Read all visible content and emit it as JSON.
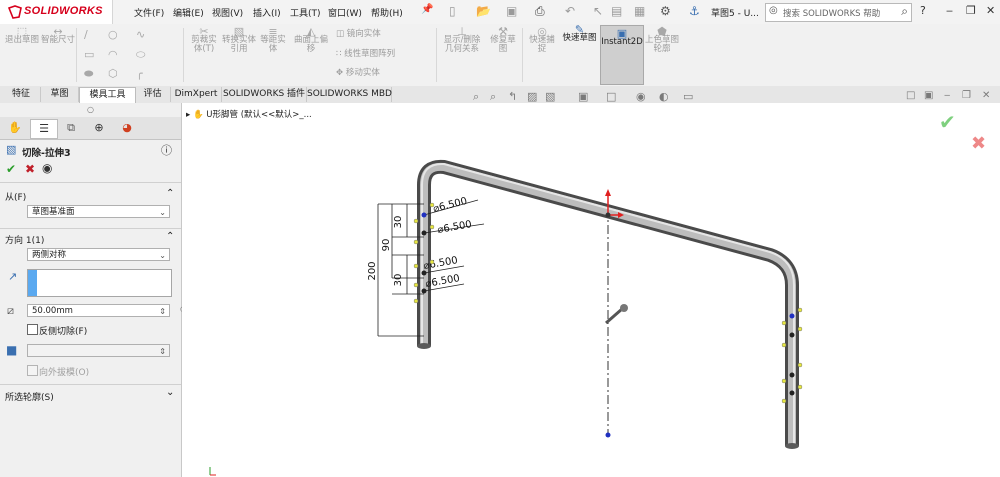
{
  "app": {
    "brand": "SOLIDWORKS",
    "doc_title": "草图5 - U..."
  },
  "menu": [
    {
      "key": "file",
      "label": "文件(F)"
    },
    {
      "key": "edit",
      "label": "编辑(E)"
    },
    {
      "key": "view",
      "label": "视图(V)"
    },
    {
      "key": "insert",
      "label": "插入(I)"
    },
    {
      "key": "tools",
      "label": "工具(T)"
    },
    {
      "key": "window",
      "label": "窗口(W)"
    },
    {
      "key": "help",
      "label": "帮助(H)"
    }
  ],
  "search": {
    "placeholder": "搜索 SOLIDWORKS 帮助"
  },
  "ribbon": {
    "exit_sketch": "退出草图",
    "smart_dim": "智能尺寸",
    "trim": "剪裁实体(T)",
    "convert": "转换实体引用",
    "offset": "等距实体",
    "surface_offset": "曲面上偏移",
    "mirror": "镜向实体",
    "linear_pattern": "线性草图阵列",
    "move": "移动实体",
    "display_delete": "显示/删除几何关系",
    "repair": "修复草图",
    "quick_snap": "快速捕捉",
    "quick_sketch": "快速草图",
    "instant2d": "Instant2D",
    "shaded_sketch": "上色草图轮廓"
  },
  "tabs": [
    {
      "key": "feature",
      "label": "特征"
    },
    {
      "key": "sketch",
      "label": "草图"
    },
    {
      "key": "mold",
      "label": "模具工具"
    },
    {
      "key": "evaluate",
      "label": "评估"
    },
    {
      "key": "dimxpert",
      "label": "DimXpert"
    },
    {
      "key": "addins",
      "label": "SOLIDWORKS 插件"
    },
    {
      "key": "mbd",
      "label": "SOLIDWORKS MBD"
    }
  ],
  "property_manager": {
    "title": "切除-拉伸3",
    "from": {
      "header": "从(F)",
      "value": "草图基准面"
    },
    "direction": {
      "header": "方向 1(1)",
      "end_condition": "两侧对称",
      "depth": "50.00mm"
    },
    "flip_side": "反侧切除(F)",
    "draft_outward": "向外拔模(O)",
    "selected_contours": "所选轮廓(S)"
  },
  "tree": {
    "part": "U形脚管",
    "config": "(默认<<默认>_..."
  },
  "dimensions": {
    "d1": "6.500",
    "d2": "6.500",
    "d3": "6.500",
    "d4": "6.500",
    "v30a": "30",
    "v90": "90",
    "v30b": "30",
    "v200": "200"
  },
  "colors": {
    "accent": "#3a6fb0",
    "brand": "#d6001c",
    "selected": "#cfcfcf"
  }
}
